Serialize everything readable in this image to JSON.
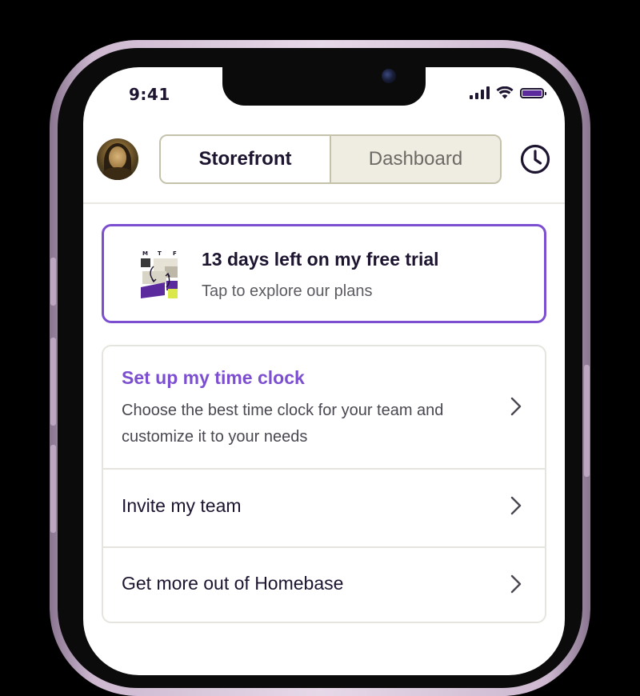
{
  "status_bar": {
    "time": "9:41"
  },
  "header": {
    "tabs": [
      {
        "label": "Storefront",
        "active": true
      },
      {
        "label": "Dashboard",
        "active": false
      }
    ]
  },
  "trial": {
    "title": "13 days left on my free trial",
    "subtitle": "Tap to explore our plans",
    "illustration_letters": [
      "M",
      "T",
      "F"
    ]
  },
  "list": {
    "setup": {
      "title": "Set up my time clock",
      "description": "Choose the best time clock for your team and customize it to your needs"
    },
    "invite": {
      "label": "Invite my team"
    },
    "more": {
      "label": "Get more out of Homebase"
    }
  },
  "colors": {
    "accent": "#7b4fd0",
    "text_dark": "#1d1430",
    "illustration_yellow": "#dbe84a",
    "illustration_purple": "#5b2b9e"
  }
}
